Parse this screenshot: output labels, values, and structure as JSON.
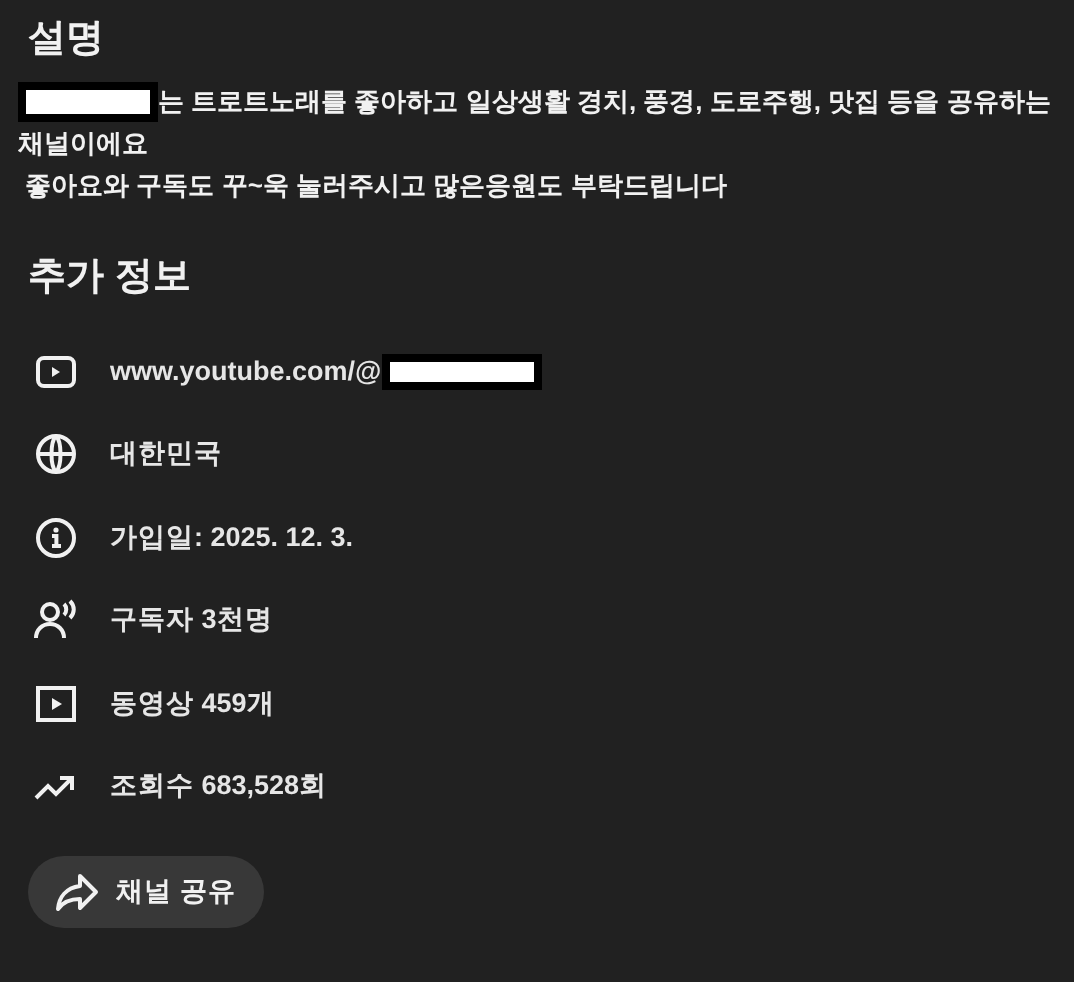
{
  "description": {
    "heading": "설명",
    "lines": [
      "는 트로트노래를 좋아하고 일상생활 경치, 풍경, 도로주행, 맛집 등을 공유하는",
      "채널이에요",
      " 좋아요와 구독도 꾸~욱 눌러주시고 많은응원도 부탁드립니다"
    ]
  },
  "details": {
    "heading": "추가 정보",
    "rows": [
      {
        "kind": "link",
        "text": "www.youtube.com/@"
      },
      {
        "kind": "country",
        "text": "대한민국"
      },
      {
        "kind": "joined",
        "text": "가입일: 2025. 12. 3."
      },
      {
        "kind": "subscribers",
        "text": "구독자 3천명"
      },
      {
        "kind": "videos",
        "text": "동영상 459개"
      },
      {
        "kind": "views",
        "text": "조회수 683,528회"
      }
    ]
  },
  "share_button": {
    "label": "채널 공유"
  }
}
